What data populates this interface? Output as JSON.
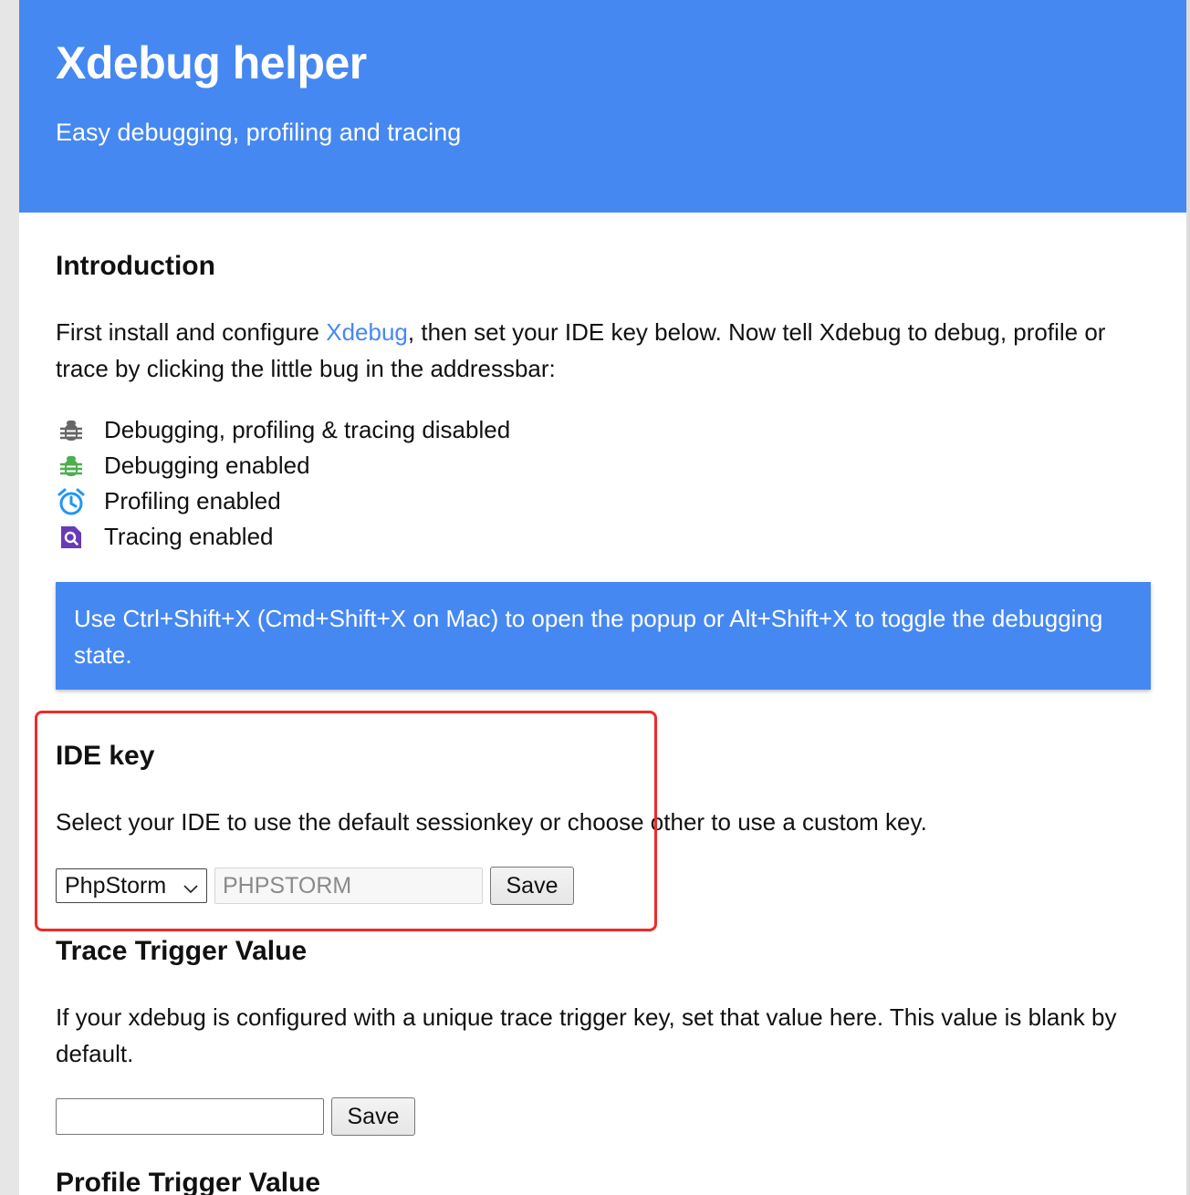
{
  "header": {
    "title": "Xdebug helper",
    "subtitle": "Easy debugging, profiling and tracing"
  },
  "intro": {
    "title": "Introduction",
    "text_before_link": "First install and configure ",
    "link_text": "Xdebug",
    "text_after_link": ", then set your IDE key below. Now tell Xdebug to debug, profile or trace by clicking the little bug in the addressbar:"
  },
  "status_items": [
    {
      "icon": "bug-gray-icon",
      "label": "Debugging, profiling & tracing disabled",
      "color": "#666666"
    },
    {
      "icon": "bug-green-icon",
      "label": "Debugging enabled",
      "color": "#4caf50"
    },
    {
      "icon": "alarm-clock-icon",
      "label": "Profiling enabled",
      "color": "#2196f3"
    },
    {
      "icon": "trace-search-icon",
      "label": "Tracing enabled",
      "color": "#673ab7"
    }
  ],
  "notice": {
    "text": "Use Ctrl+Shift+X (Cmd+Shift+X on Mac) to open the popup or Alt+Shift+X to toggle the debugging state."
  },
  "ide_key": {
    "title": "IDE key",
    "description": "Select your IDE to use the default sessionkey or choose other to use a custom key.",
    "selected_ide": "PhpStorm",
    "key_value": "PHPSTORM",
    "save_label": "Save"
  },
  "trace_trigger": {
    "title": "Trace Trigger Value",
    "description": "If your xdebug is configured with a unique trace trigger key, set that value here. This value is blank by default.",
    "value": "",
    "save_label": "Save"
  },
  "profile_trigger": {
    "title": "Profile Trigger Value"
  },
  "colors": {
    "brand_blue": "#4688f1",
    "highlight_red": "#ee2b25"
  }
}
